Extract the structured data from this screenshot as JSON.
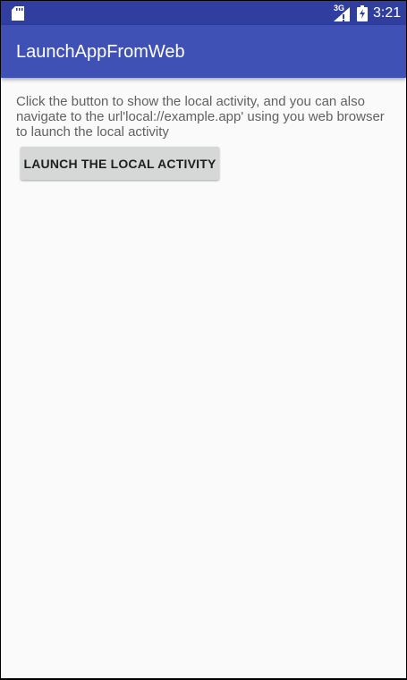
{
  "status_bar": {
    "sd_icon": "sd-card-icon",
    "network": "3G",
    "signal_icon": "signal-strength-icon",
    "battery_icon": "battery-charging-icon",
    "time": "3:21"
  },
  "app_bar": {
    "title": "LaunchAppFromWeb"
  },
  "main": {
    "description": "Click the button to show the local activity, and you can also navigate to the url'local://example.app' using you web browser to launch the local activity",
    "launch_button_label": "LAUNCH THE LOCAL ACTIVITY"
  },
  "colors": {
    "status_bar": "#303f9f",
    "app_bar": "#3f51b5",
    "background": "#fafafa",
    "button": "#d6d7d7"
  }
}
